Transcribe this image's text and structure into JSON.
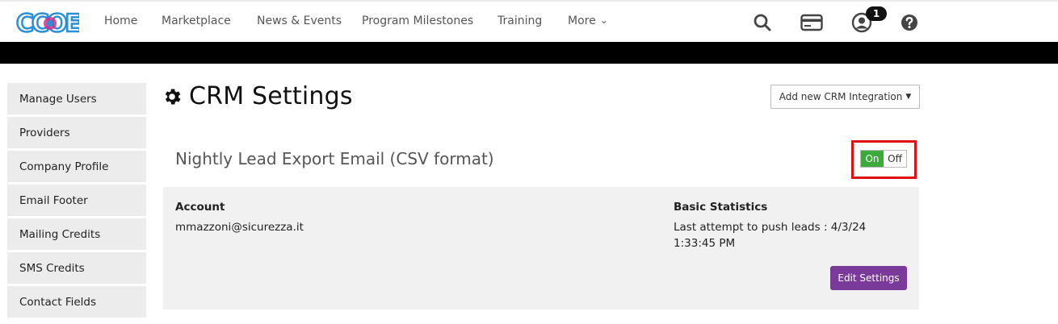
{
  "header": {
    "logo_text": "CCOE",
    "nav": [
      {
        "label": "Home"
      },
      {
        "label": "Marketplace"
      },
      {
        "label": "News & Events"
      },
      {
        "label": "Program Milestones"
      },
      {
        "label": "Training"
      },
      {
        "label": "More"
      }
    ],
    "icons": [
      "search-icon",
      "credit-card-icon",
      "user-icon",
      "help-icon"
    ],
    "notification_count": "1"
  },
  "sidebar": {
    "items": [
      {
        "label": "Manage Users"
      },
      {
        "label": "Providers"
      },
      {
        "label": "Company Profile"
      },
      {
        "label": "Email Footer"
      },
      {
        "label": "Mailing Credits"
      },
      {
        "label": "SMS Credits"
      },
      {
        "label": "Contact Fields"
      }
    ]
  },
  "main": {
    "title": "CRM Settings",
    "add_button_label": "Add new CRM Integration",
    "card": {
      "title": "Nightly Lead Export Email (CSV format)",
      "toggle": {
        "on_label": "On",
        "off_label": "Off",
        "state": "on"
      },
      "account_label": "Account",
      "account_value": "mmazzoni@sicurezza.it",
      "stats_label": "Basic Statistics",
      "stats_line1": "Last attempt to push leads : 4/3/24",
      "stats_line2": "1:33:45 PM",
      "edit_button_label": "Edit Settings"
    }
  },
  "colors": {
    "toggle_on": "#3cab3c",
    "edit_button": "#7a3a9a",
    "highlight": "#e01010",
    "logo_blue": "#2a8fd6",
    "logo_accent": "#d62b8c"
  }
}
